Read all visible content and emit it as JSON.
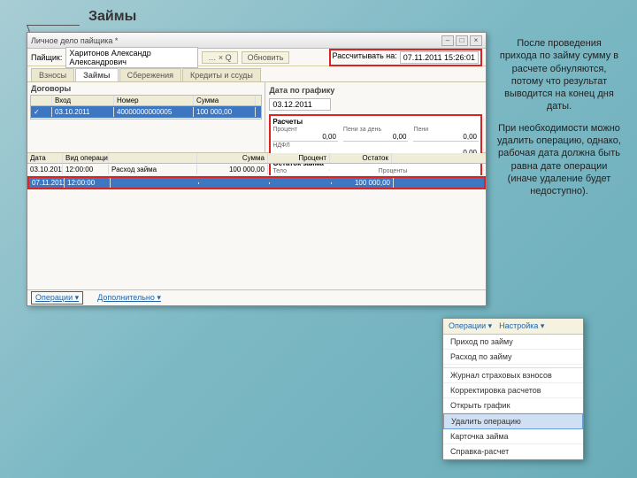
{
  "slide": {
    "title": "Займы"
  },
  "explain": {
    "p1": "После проведения прихода по займу сумму в расчете обнуляются, потому что результат выводится на конец дня даты.",
    "p2": "При необходимости можно удалить операцию, однако, рабочая дата должна быть равна дате операции (иначе удаление будет недоступно)."
  },
  "window": {
    "title": "Личное дело пайщика *",
    "pайщик_label": "Пайщик:",
    "pайщик_value": "Харитонов Александр Александрович",
    "btn_more": "… × Q",
    "btn_refresh": "Обновить",
    "calc_on_label": "Рассчитывать на:",
    "calc_on_date": "07.11.2011 15:26:01",
    "tabs": [
      "Взносы",
      "Займы",
      "Сбережения",
      "Кредиты и ссуды"
    ],
    "contracts": {
      "label": "Договоры",
      "cols": [
        "",
        "Вход",
        "Номер",
        "Сумма"
      ],
      "row": {
        "icon": "✓",
        "date": "03.10.2011",
        "num": "40000000000005",
        "sum": "100 000,00"
      }
    },
    "date_section": {
      "label": "Дата по графику",
      "value": "03.12.2011"
    },
    "calc": {
      "title": "Расчеты",
      "percent_lbl": "Процент",
      "penalty_lbl": "Пени за день",
      "penalty2_lbl": "Пени",
      "percent": "0,00",
      "penalty": "0,00",
      "penalty2": "0,00",
      "ndfl_lbl": "НДФЛ",
      "ndfl": "0,00",
      "balance_title": "Остаток займа",
      "body_lbl": "Тело",
      "body_val": "100 000,00",
      "proc_lbl": "Проценты",
      "proc_val": "0,00"
    },
    "ops": {
      "cols": [
        "Дата",
        "Вид операции",
        "",
        "Сумма",
        "Процент",
        "Остаток"
      ],
      "row1": {
        "date": "03.10.2011",
        "time": "12:00:00",
        "kind": "Расход займа",
        "sum": "100 000,00",
        "proc": "",
        "bal": ""
      },
      "row2": {
        "date": "07.11.2011",
        "time": "12:00:00",
        "kind": "",
        "sum": "",
        "proc": "",
        "bal": "100 000,00"
      }
    },
    "footer": {
      "ops": "Операции ▾",
      "extra": "Дополнительно ▾"
    }
  },
  "menu": {
    "head1": "Операции ▾",
    "head2": "Настройка ▾",
    "items": [
      "Приход по займу",
      "Расход по займу",
      "Журнал страховых взносов",
      "Корректировка расчетов",
      "Открыть график",
      "Удалить операцию",
      "Карточка займа",
      "Справка-расчет"
    ]
  }
}
